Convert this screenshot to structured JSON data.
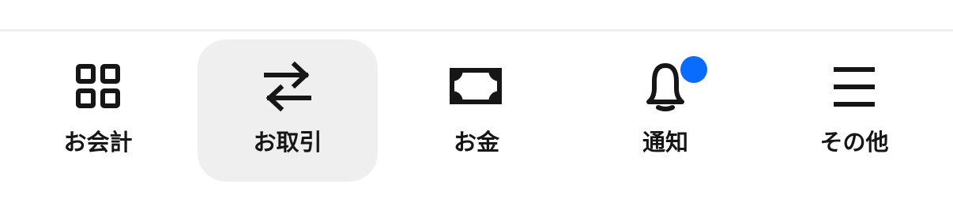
{
  "tabs": [
    {
      "label": "お会計",
      "icon": "grid-icon",
      "selected": false
    },
    {
      "label": "お取引",
      "icon": "transfer-arrows-icon",
      "selected": true
    },
    {
      "label": "お金",
      "icon": "banknote-icon",
      "selected": false
    },
    {
      "label": "通知",
      "icon": "bell-icon",
      "selected": false,
      "has_badge": true
    },
    {
      "label": "その他",
      "icon": "menu-icon",
      "selected": false
    }
  ],
  "colors": {
    "background": "#ffffff",
    "selected_background": "#efefef",
    "icon": "#161616",
    "badge": "#0a6cff",
    "divider": "#eeeeee"
  }
}
